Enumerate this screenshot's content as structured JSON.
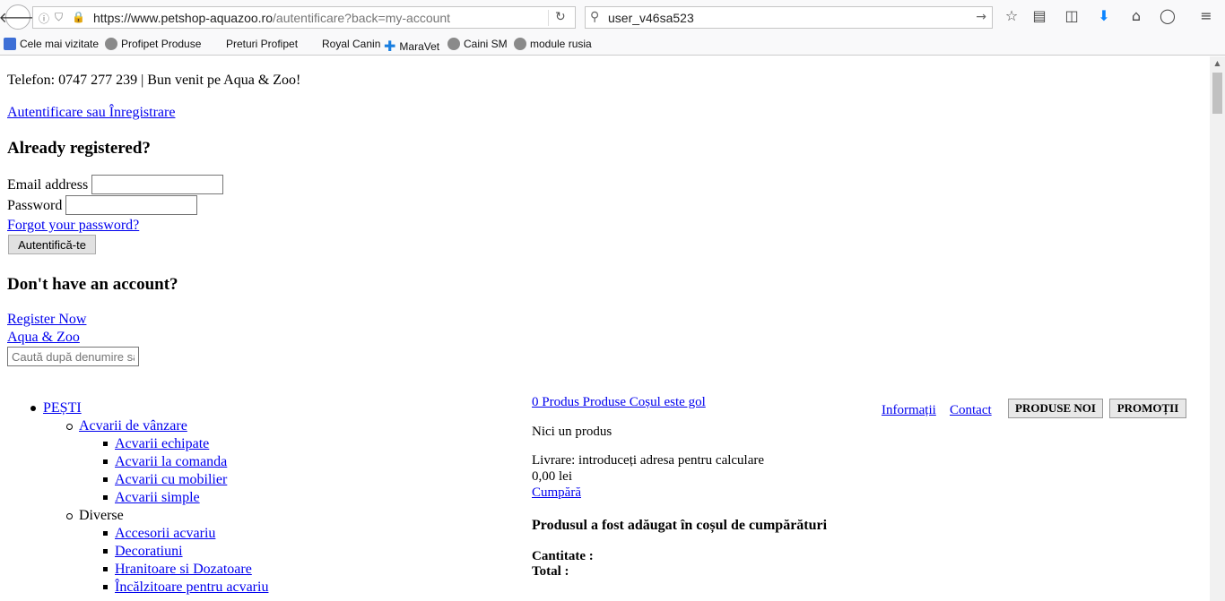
{
  "browser": {
    "url_host": "https://www.petshop-aquazoo.ro",
    "url_path": "/autentificare?back=my-account",
    "search_value": "user_v46sa523"
  },
  "bookmarks": [
    "Cele mai vizitate",
    "Profipet Produse",
    "Preturi Profipet",
    "Royal Canin",
    "MaraVet",
    "Caini SM",
    "module rusia"
  ],
  "header": {
    "phone_line": "Telefon: 0747 277 239 | Bun venit pe Aqua & Zoo!",
    "auth_link": "Autentificare sau Înregistrare"
  },
  "login": {
    "heading": "Already registered?",
    "email_label": "Email address",
    "password_label": "Password",
    "forgot_link": "Forgot your password?",
    "submit_label": "Autentifică-te"
  },
  "register": {
    "heading": "Don't have an account?",
    "register_link": "Register Now",
    "home_link": "Aqua & Zoo",
    "search_placeholder": "Caută după denumire sau"
  },
  "menu": {
    "top": "PEȘTI",
    "sub1": "Acvarii de vânzare",
    "sub1_items": [
      "Acvarii echipate",
      "Acvarii la comanda",
      "Acvarii cu mobilier",
      "Acvarii simple"
    ],
    "sub2": "Diverse",
    "sub2_items": [
      "Accesorii acvariu",
      "Decoratiuni",
      "Hranitoare si Dozatoare",
      "Încălzitoare pentru acvariu"
    ]
  },
  "cart": {
    "summary_link": "0 Produs Produse Coșul este gol",
    "no_product": "Nici un produs",
    "shipping": "Livrare: introduceți adresa pentru calculare",
    "amount": "0,00 lei",
    "buy_link": "Cumpără",
    "added_heading": "Produsul a fost adăugat în coșul de cumpărături",
    "quantity_label": "Cantitate :",
    "total_label": "Total :"
  },
  "nav": {
    "info": "Informații",
    "contact": "Contact",
    "new_products": "PRODUSE NOI",
    "promotions": "PROMOȚII"
  }
}
